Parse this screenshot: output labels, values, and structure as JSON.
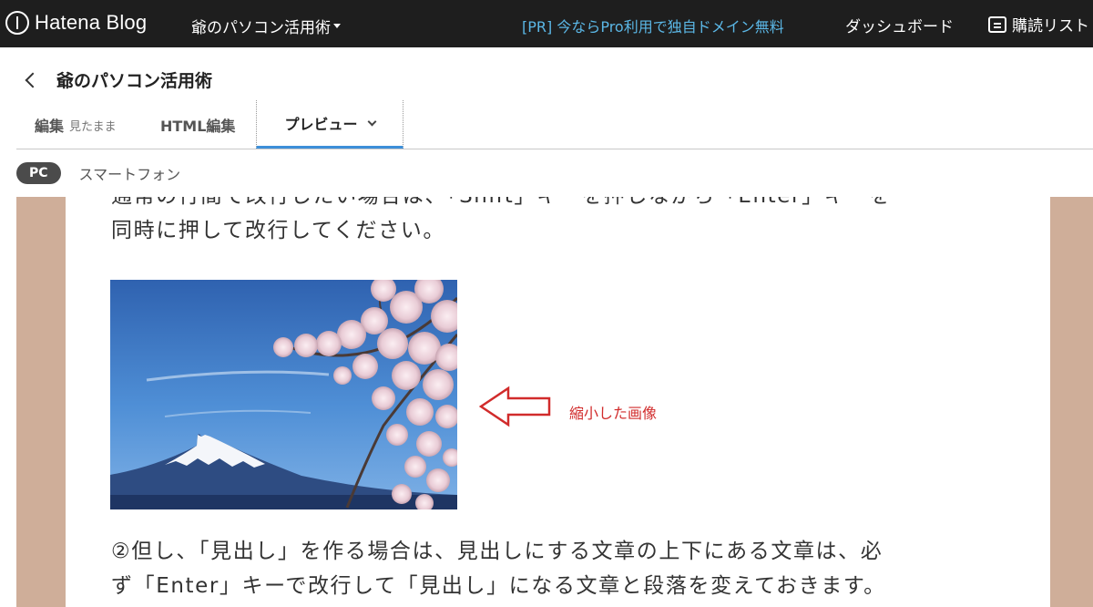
{
  "topbar": {
    "logo_text": "Hatena Blog",
    "blog_name": "爺のパソコン活用術",
    "promo": "[PR] 今ならPro利用で独自ドメイン無料",
    "dashboard": "ダッシュボード",
    "reading_list": "購読リスト"
  },
  "editor": {
    "back_label": "爺のパソコン活用術",
    "tabs": {
      "edit": "編集",
      "edit_mode": "見たまま",
      "html": "HTML編集",
      "preview": "プレビュー"
    },
    "device": {
      "pc": "PC",
      "smartphone": "スマートフォン"
    }
  },
  "preview": {
    "para_top_line1": "通常の行間で改行したい場合は、「Shift」キーを押しながら「Enter」キーを",
    "para_top_line2": "同時に押して改行してください。",
    "annotation": "縮小した画像",
    "para_bottom_line1": "②但し、「見出し」を作る場合は、見出しにする文章の上下にある文章は、必",
    "para_bottom_line2": "ず「Enter」キーで改行して「見出し」になる文章と段落を変えておきます。"
  },
  "colors": {
    "topbar_bg": "#1e1e1e",
    "promo_link": "#5bb7e6",
    "active_tab_underline": "#3d8fd9",
    "preview_side_bg": "#cfae99",
    "annotation_red": "#d12b2b"
  },
  "icons": [
    "hatena-logo-icon",
    "back-arrow-icon",
    "chevron-down-icon",
    "reading-list-icon",
    "left-arrow-outline-icon"
  ]
}
